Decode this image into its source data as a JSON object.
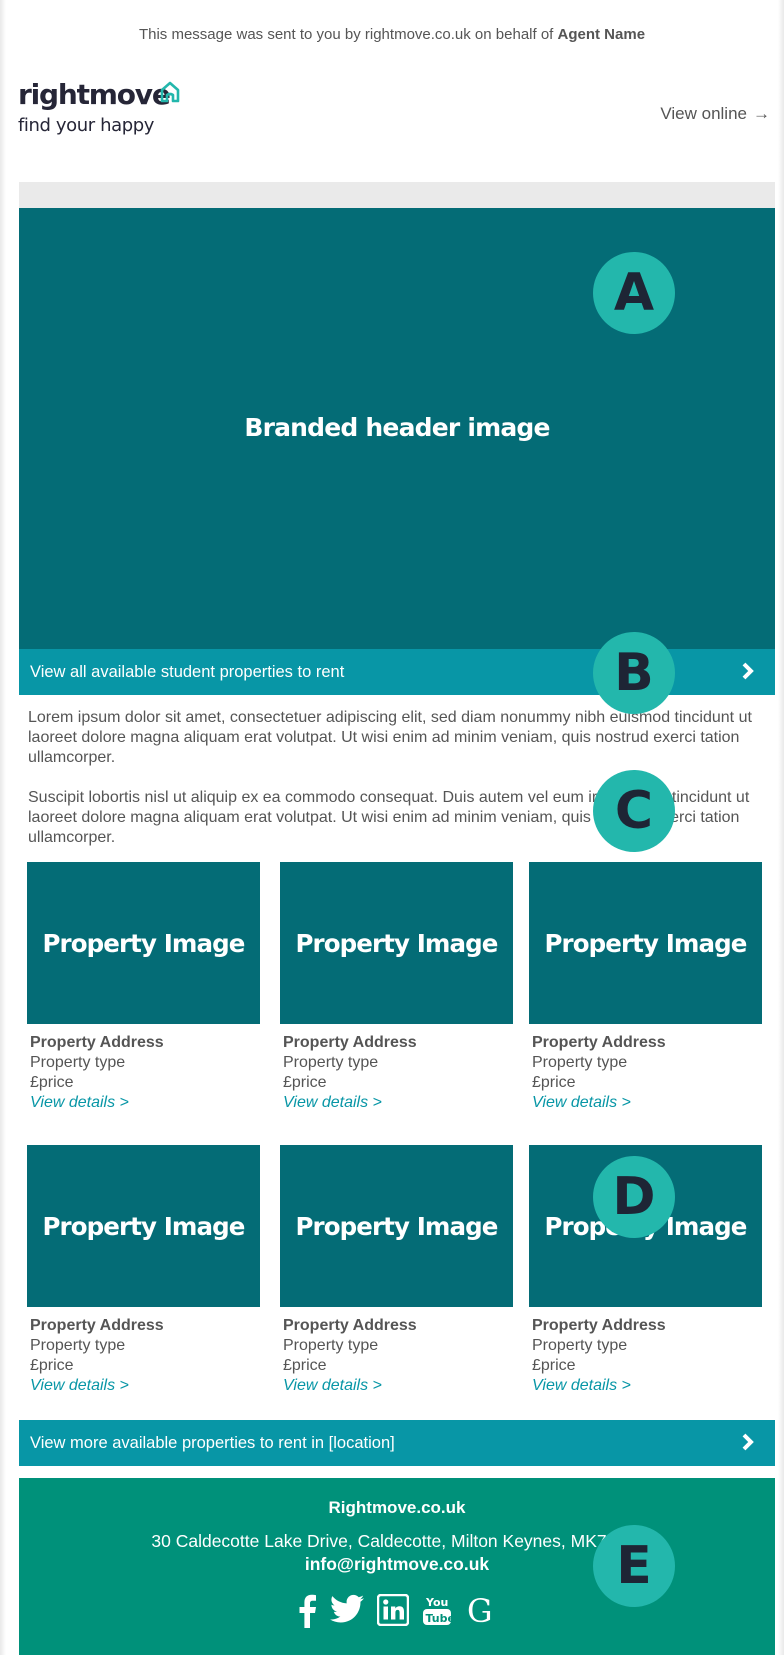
{
  "preheader": {
    "text": "This message was sent to you by rightmove.co.uk on behalf of ",
    "agent": "Agent Name"
  },
  "logo": {
    "brand": "rightmove",
    "tagline": "find your happy",
    "icon": "house-outline-icon"
  },
  "header": {
    "view_online": "View online",
    "arrow": "→"
  },
  "hero": {
    "text": "Branded header image"
  },
  "cta_top": {
    "label": "View all available student properties to rent",
    "icon": "chevron-right-icon"
  },
  "body": {
    "paragraphs": [
      "Lorem ipsum dolor sit amet, consectetuer adipiscing elit, sed diam nonummy nibh euismod tincidunt ut laoreet dolore magna aliquam erat volutpat. Ut wisi enim ad minim veniam, quis nostrud exerci tation ullamcorper.",
      "Suscipit lobortis nisl ut aliquip ex ea commodo consequat. Duis autem vel eum iriure dolor. tincidunt ut laoreet dolore magna aliquam erat volutpat. Ut wisi enim ad minim veniam, quis nostrud exerci tation ullamcorper."
    ]
  },
  "properties": [
    {
      "image": "Property Image",
      "address": "Property Address",
      "type": "Property type",
      "price": "£price",
      "link": "View details >"
    },
    {
      "image": "Property Image",
      "address": "Property Address",
      "type": "Property type",
      "price": "£price",
      "link": "View details >"
    },
    {
      "image": "Property Image",
      "address": "Property Address",
      "type": "Property type",
      "price": "£price",
      "link": "View details >"
    },
    {
      "image": "Property Image",
      "address": "Property Address",
      "type": "Property type",
      "price": "£price",
      "link": "View details >"
    },
    {
      "image": "Property Image",
      "address": "Property Address",
      "type": "Property type",
      "price": "£price",
      "link": "View details >"
    },
    {
      "image": "Property Image",
      "address": "Property Address",
      "type": "Property type",
      "price": "£price",
      "link": "View details >"
    }
  ],
  "cta_bottom": {
    "label": "View more available properties to rent in [location]",
    "icon": "chevron-right-icon"
  },
  "footer": {
    "site": "Rightmove.co.uk",
    "address": "30 Caldecotte Lake Drive, Caldecotte, Milton Keynes, MK7 8LE",
    "email": "info@rightmove.co.uk",
    "socials": [
      "facebook-icon",
      "twitter-icon",
      "linkedin-icon",
      "youtube-icon",
      "google-icon"
    ]
  },
  "badges": [
    "A",
    "B",
    "C",
    "D",
    "E"
  ],
  "colors": {
    "hero": "#046c76",
    "cta": "#0896a6",
    "footer": "#00917a",
    "badge": "#23b7ac",
    "badge_text": "#1e2535",
    "link": "#0896a6"
  }
}
